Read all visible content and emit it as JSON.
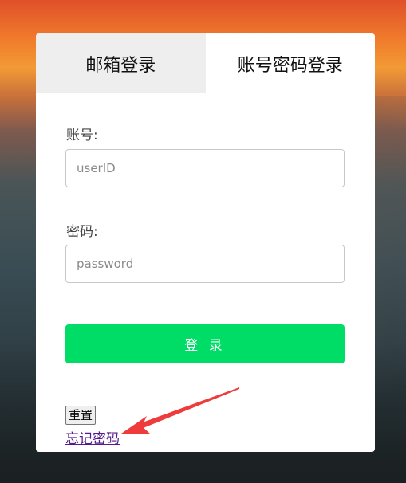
{
  "tabs": [
    {
      "label": "邮箱登录",
      "active": false
    },
    {
      "label": "账号密码登录",
      "active": true
    }
  ],
  "form": {
    "account_label": "账号:",
    "account_placeholder": "userID",
    "password_label": "密码:",
    "password_placeholder": "password",
    "login_label": "登 录",
    "reset_label": "重置",
    "forgot_label": "忘记密码"
  },
  "colors": {
    "login_button": "#00dd66",
    "annotation_arrow": "#ee3b3b",
    "link": "#551a8b"
  }
}
